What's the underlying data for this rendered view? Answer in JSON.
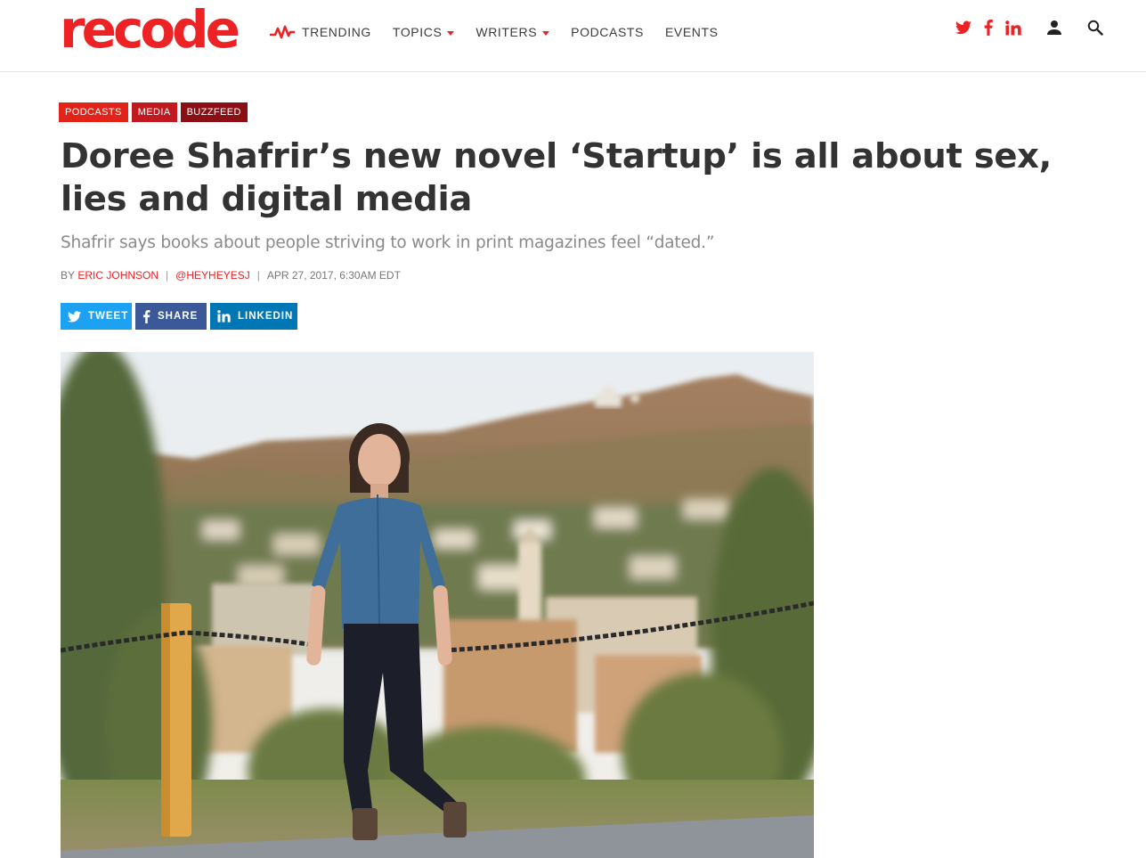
{
  "header": {
    "logo": "recode",
    "nav": [
      {
        "label": "TRENDING",
        "icon": "trending-icon"
      },
      {
        "label": "TOPICS",
        "dropdown": true
      },
      {
        "label": "WRITERS",
        "dropdown": true
      },
      {
        "label": "PODCASTS"
      },
      {
        "label": "EVENTS"
      }
    ],
    "social_icons": [
      "twitter-icon",
      "facebook-icon",
      "linkedin-icon"
    ],
    "utility_icons": [
      "user-icon",
      "search-icon"
    ]
  },
  "article": {
    "tags": [
      "PODCASTS",
      "MEDIA",
      "BUZZFEED"
    ],
    "headline": "Doree Shafrir’s new novel ‘Startup’ is all about sex, lies and digital media",
    "dek": "Shafrir says books about people striving to work in print magazines feel “dated.”",
    "byline": {
      "by": "BY",
      "author": "ERIC JOHNSON",
      "handle": "@HEYHEYESJ",
      "date": "APR 27, 2017, 6:30AM EDT"
    },
    "share": {
      "tweet": "TWEET",
      "share": "SHARE",
      "linkedin": "LINKEDIN"
    }
  },
  "colors": {
    "brand_red": "#ed2224",
    "tag_podcasts": "#e2231a",
    "tag_media": "#c1191f",
    "tag_buzzfeed": "#8a1016",
    "twitter": "#1da1f2",
    "facebook": "#3b5998",
    "linkedin": "#0077b5",
    "headline": "#333333",
    "dek": "#8a8a8a"
  }
}
